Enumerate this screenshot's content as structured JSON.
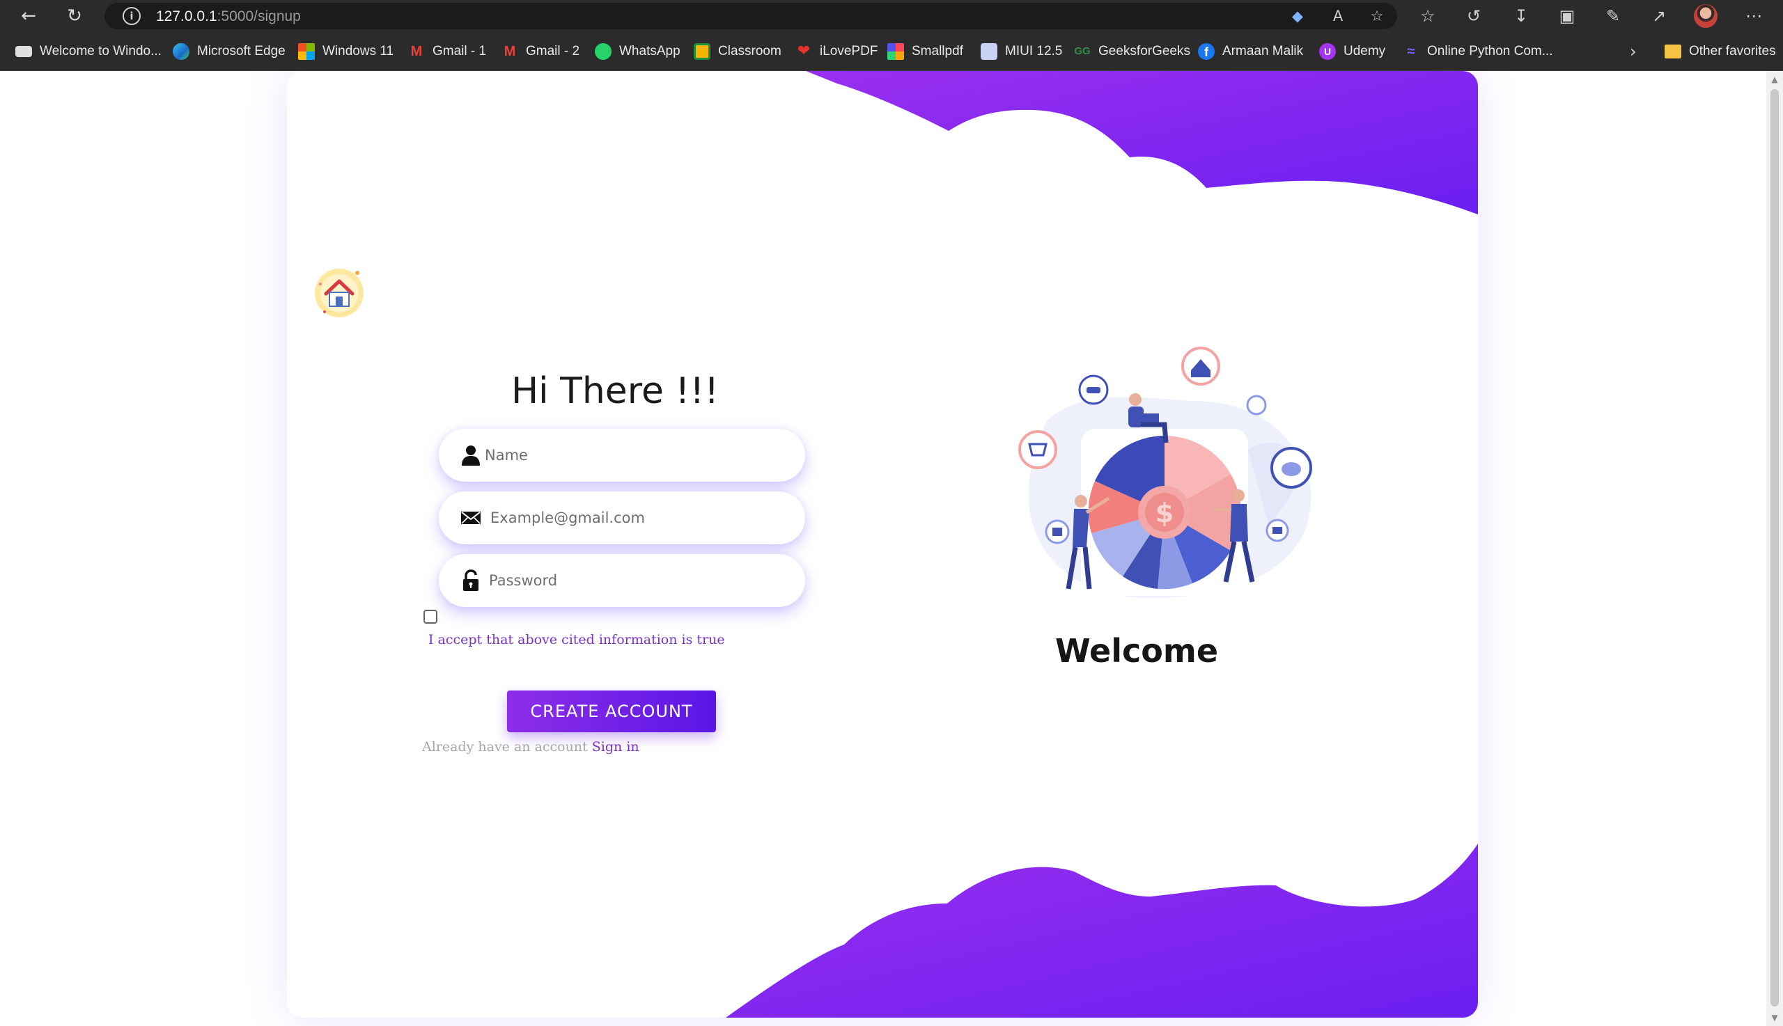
{
  "browser": {
    "url_host": "127.0.0.1",
    "url_path": ":5000/signup",
    "bookmarks": [
      {
        "label": "Welcome to Windo...",
        "icon": "folder-tab-icon",
        "color": "#e0e0e0"
      },
      {
        "label": "Microsoft Edge",
        "icon": "edge-icon",
        "color": "#2fa8e0"
      },
      {
        "label": "Windows 11",
        "icon": "windows-icon",
        "color": "#f25022"
      },
      {
        "label": "Gmail - 1",
        "icon": "gmail-icon",
        "color": "#ea4335"
      },
      {
        "label": "Gmail - 2",
        "icon": "gmail-icon",
        "color": "#ea4335"
      },
      {
        "label": "WhatsApp",
        "icon": "whatsapp-icon",
        "color": "#25d366"
      },
      {
        "label": "Classroom",
        "icon": "classroom-icon",
        "color": "#f4b400"
      },
      {
        "label": "iLovePDF",
        "icon": "ilovepdf-icon",
        "color": "#e5322d"
      },
      {
        "label": "Smallpdf",
        "icon": "smallpdf-icon",
        "color": "#6c5ce7"
      },
      {
        "label": "MIUI 12.5",
        "icon": "miui-icon",
        "color": "#b8c4f0"
      },
      {
        "label": "GeeksforGeeks",
        "icon": "gfg-icon",
        "color": "#2f8d46"
      },
      {
        "label": "Armaan Malik",
        "icon": "facebook-icon",
        "color": "#1877f2"
      },
      {
        "label": "Udemy",
        "icon": "udemy-icon",
        "color": "#a435f0"
      },
      {
        "label": "Online Python Com...",
        "icon": "python-icon",
        "color": "#7b61ff"
      }
    ],
    "other_favorites": "Other favorites"
  },
  "page": {
    "heading": "Hi There !!!",
    "name_placeholder": "Name",
    "email_placeholder": "Example@gmail.com",
    "password_placeholder": "Password",
    "accept_text": "I accept that above cited information is true",
    "create_button": "CREATE ACCOUNT",
    "already_text": "Already have an account",
    "signin_link": "Sign in",
    "welcome": "Welcome"
  },
  "colors": {
    "accent_purple": "#7b2ff7",
    "button_start": "#8d2ee8",
    "button_end": "#5a16e6"
  }
}
